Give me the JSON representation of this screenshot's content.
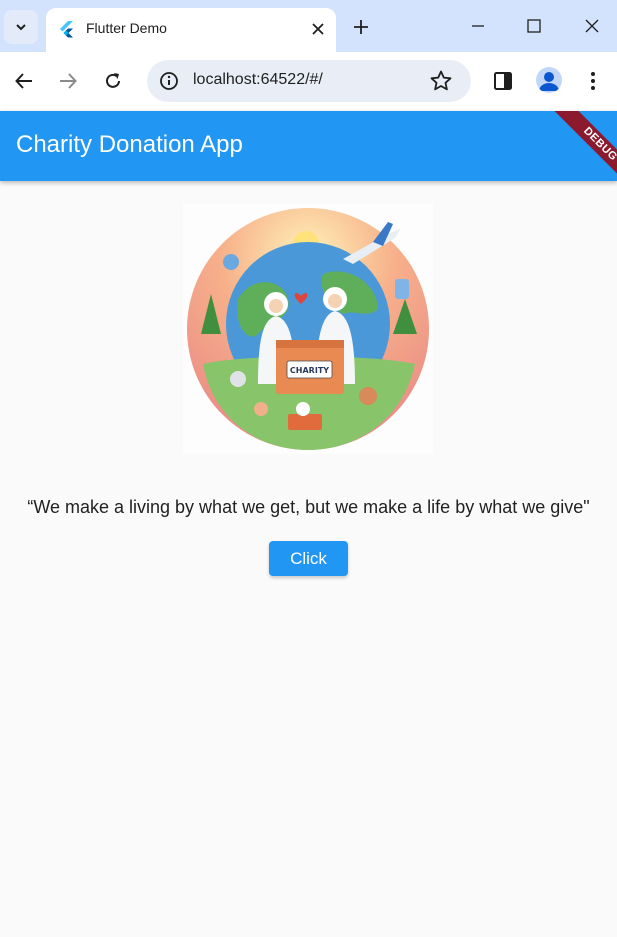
{
  "browser": {
    "tab": {
      "title": "Flutter Demo",
      "favicon": "flutter-logo-icon"
    },
    "address_bar": {
      "url": "localhost:64522/#/"
    },
    "icons": {
      "tab_search": "chevron-down-icon",
      "close_tab": "close-icon",
      "new_tab": "plus-icon",
      "minimize": "minimize-icon",
      "maximize": "maximize-icon",
      "close_window": "close-icon",
      "back": "back-arrow-icon",
      "forward": "forward-arrow-icon",
      "reload": "reload-icon",
      "site_info": "info-icon",
      "bookmark": "star-icon",
      "side_panel": "side-panel-icon",
      "profile": "profile-icon",
      "menu": "kebab-menu-icon"
    }
  },
  "app": {
    "title": "Charity Donation App",
    "debug_banner": "DEBUG",
    "quote": "“We make a living by what we get, but we make a life by what we give\"",
    "button_label": "Click",
    "image": {
      "box_label": "CHARITY"
    },
    "colors": {
      "primary": "#2196f3",
      "debug": "#8b1a2e",
      "background": "#fafafa"
    }
  }
}
